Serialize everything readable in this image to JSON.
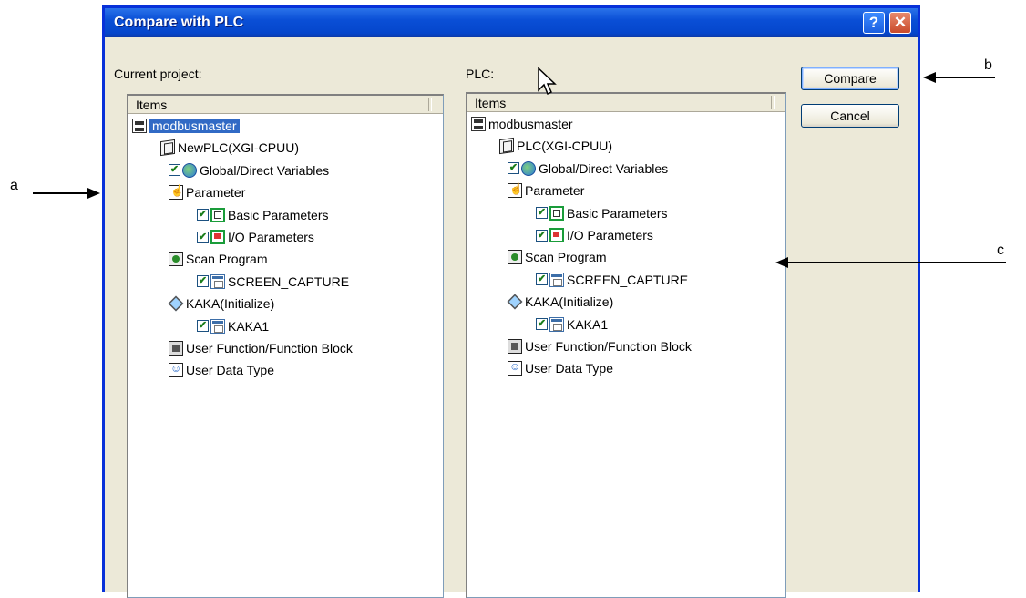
{
  "window": {
    "title": "Compare with PLC",
    "help_label": "?",
    "close_label": "✕"
  },
  "labels": {
    "current_project": "Current project:",
    "plc": "PLC:"
  },
  "left_panel": {
    "header": "Items",
    "nodes": [
      {
        "label": "modbusmaster",
        "icon": "network-icon",
        "selected": true
      },
      {
        "label": "NewPLC(XGI-CPUU)",
        "icon": "plc-cube-icon"
      },
      {
        "label": "Global/Direct Variables",
        "icon": "globe-icon",
        "checked": true
      },
      {
        "label": "Parameter",
        "icon": "hand-icon"
      },
      {
        "label": "Basic Parameters",
        "icon": "basic-param-icon",
        "checked": true
      },
      {
        "label": "I/O Parameters",
        "icon": "io-param-icon",
        "checked": true
      },
      {
        "label": "Scan Program",
        "icon": "scan-program-icon"
      },
      {
        "label": "SCREEN_CAPTURE",
        "icon": "program-icon",
        "checked": true
      },
      {
        "label": "KAKA(Initialize)",
        "icon": "diamond-icon"
      },
      {
        "label": "KAKA1",
        "icon": "program-icon",
        "checked": true
      },
      {
        "label": "User Function/Function Block",
        "icon": "function-block-icon"
      },
      {
        "label": "User Data Type",
        "icon": "user-data-type-icon"
      }
    ]
  },
  "right_panel": {
    "header": "Items",
    "nodes": [
      {
        "label": "modbusmaster",
        "icon": "network-icon"
      },
      {
        "label": "PLC(XGI-CPUU)",
        "icon": "plc-cube-icon"
      },
      {
        "label": "Global/Direct Variables",
        "icon": "globe-icon",
        "checked": true
      },
      {
        "label": "Parameter",
        "icon": "hand-icon"
      },
      {
        "label": "Basic Parameters",
        "icon": "basic-param-icon",
        "checked": true
      },
      {
        "label": "I/O Parameters",
        "icon": "io-param-icon",
        "checked": true
      },
      {
        "label": "Scan Program",
        "icon": "scan-program-icon"
      },
      {
        "label": "SCREEN_CAPTURE",
        "icon": "program-icon",
        "checked": true
      },
      {
        "label": "KAKA(Initialize)",
        "icon": "diamond-icon"
      },
      {
        "label": "KAKA1",
        "icon": "program-icon",
        "checked": true
      },
      {
        "label": "User Function/Function Block",
        "icon": "function-block-icon"
      },
      {
        "label": "User Data Type",
        "icon": "user-data-type-icon"
      }
    ]
  },
  "buttons": {
    "compare": "Compare",
    "cancel": "Cancel"
  },
  "annotations": {
    "a": "a",
    "b": "b",
    "c": "c"
  },
  "colors": {
    "titlebar": "#0a4fd6",
    "selection": "#316ac5",
    "dialog_bg": "#ece9d8"
  }
}
